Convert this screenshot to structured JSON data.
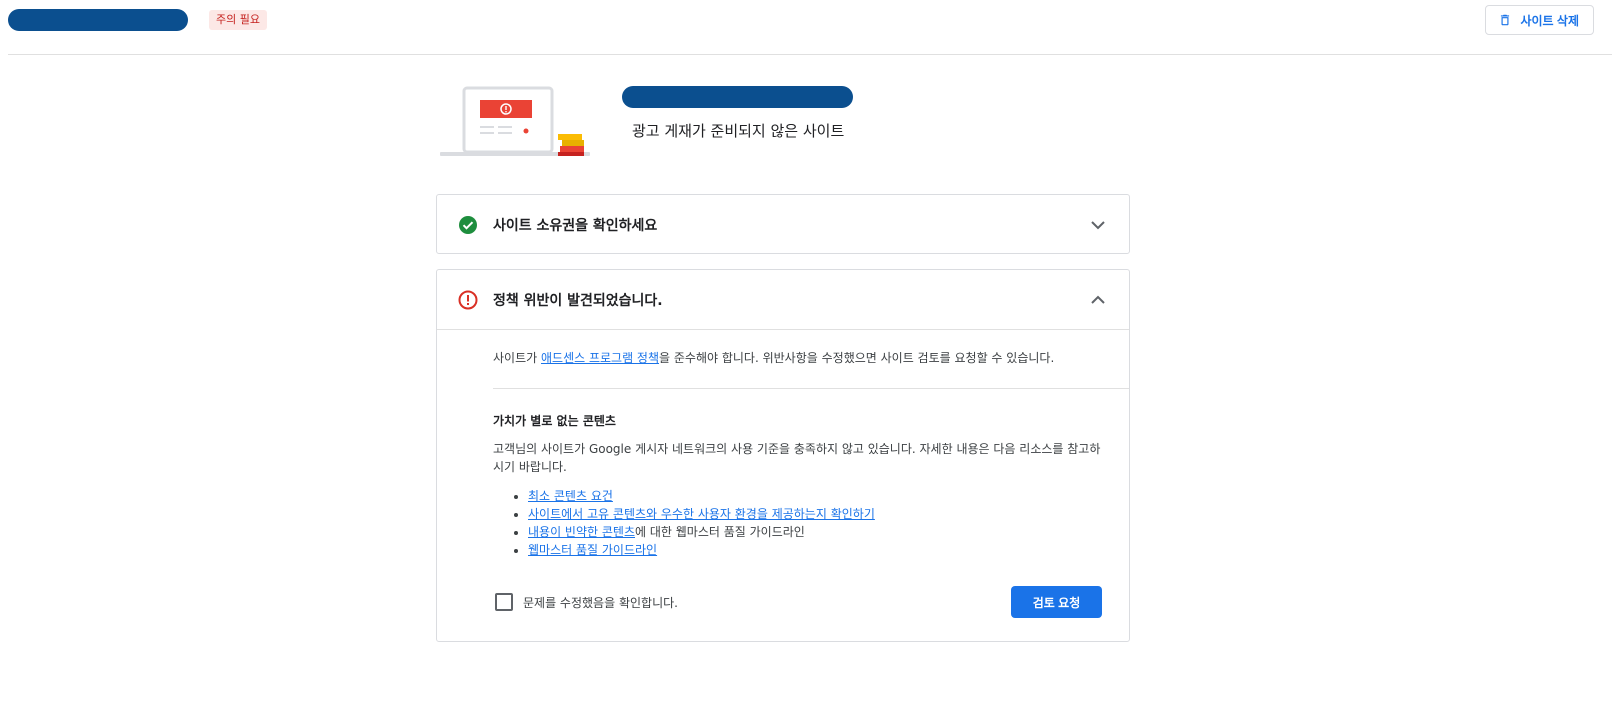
{
  "header": {
    "badge": "주의 필요",
    "delete_button": "사이트 삭제",
    "delete_icon": "trash-icon"
  },
  "hero": {
    "subtitle": "광고 게재가 준비되지 않은 사이트"
  },
  "ownership": {
    "title": "사이트 소유권을 확인하세요",
    "status_icon": "check-circle-icon",
    "chevron_icon": "chevron-down-icon"
  },
  "policy": {
    "title": "정책 위반이 발견되었습니다.",
    "status_icon": "error-circle-icon",
    "chevron_icon": "chevron-up-icon",
    "intro_prefix": "사이트가 ",
    "intro_link": "애드센스 프로그램 정책",
    "intro_suffix": "을 준수해야 합니다. 위반사항을 수정했으면 사이트 검토를 요청할 수 있습니다.",
    "section_title": "가치가 별로 없는 콘텐츠",
    "section_desc": "고객님의 사이트가 Google 게시자 네트워크의 사용 기준을 충족하지 않고 있습니다. 자세한 내용은 다음 리소스를 참고하시기 바랍니다.",
    "resources": [
      {
        "link": "최소 콘텐츠 요건",
        "suffix": ""
      },
      {
        "link": "사이트에서 고유 콘텐츠와 우수한 사용자 환경을 제공하는지 확인하기",
        "suffix": ""
      },
      {
        "link": "내용이 빈약한 콘텐츠",
        "suffix": "에 대한 웹마스터 품질 가이드라인"
      },
      {
        "link": "웹마스터 품질 가이드라인",
        "suffix": ""
      }
    ],
    "confirm_label": "문제를 수정했음을 확인합니다.",
    "confirm_checked": false,
    "review_button": "검토 요청"
  },
  "colors": {
    "accent": "#1a73e8",
    "success": "#1e8e3e",
    "error": "#d93025",
    "pill": "#0b4f8f",
    "badge_bg": "#fce8e6",
    "badge_text": "#c5221f"
  }
}
